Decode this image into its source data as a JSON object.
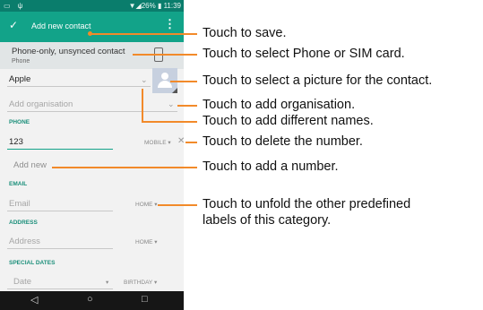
{
  "status": {
    "left_icons": "▭ ψ",
    "right": "▼◢26% ▮ 11:39"
  },
  "appbar": {
    "check_icon": "✓",
    "title": "Add new contact",
    "more_icon": "⋮"
  },
  "account": {
    "name": "Phone-only, unsynced contact",
    "type": "Phone"
  },
  "fields": {
    "name_value": "Apple",
    "org_placeholder": "Add organisation",
    "phone_section": "PHONE",
    "phone_value": "123",
    "phone_label": "MOBILE ▾",
    "delete_icon": "✕",
    "add_new": "Add new",
    "email_section": "EMAIL",
    "email_placeholder": "Email",
    "email_label": "HOME ▾",
    "address_section": "ADDRESS",
    "address_placeholder": "Address",
    "address_label": "HOME ▾",
    "dates_section": "SPECIAL DATES",
    "date_placeholder": "Date",
    "date_label": "BIRTHDAY ▾",
    "chevron": "⌄"
  },
  "navbar": {
    "back": "◁",
    "home": "○",
    "recents": "□"
  },
  "callouts": [
    "Touch to save.",
    "Touch to select Phone or SIM card.",
    "Touch to select a picture for the contact.",
    "Touch to add organisation.",
    "Touch to add different names.",
    "Touch to delete the number.",
    "Touch to add a number.",
    "Touch to unfold the other predefined",
    "labels of this category."
  ],
  "colors": {
    "status_bar": "#0a7d6c",
    "app_bar": "#12a389",
    "callout_line": "#f28a2a"
  }
}
